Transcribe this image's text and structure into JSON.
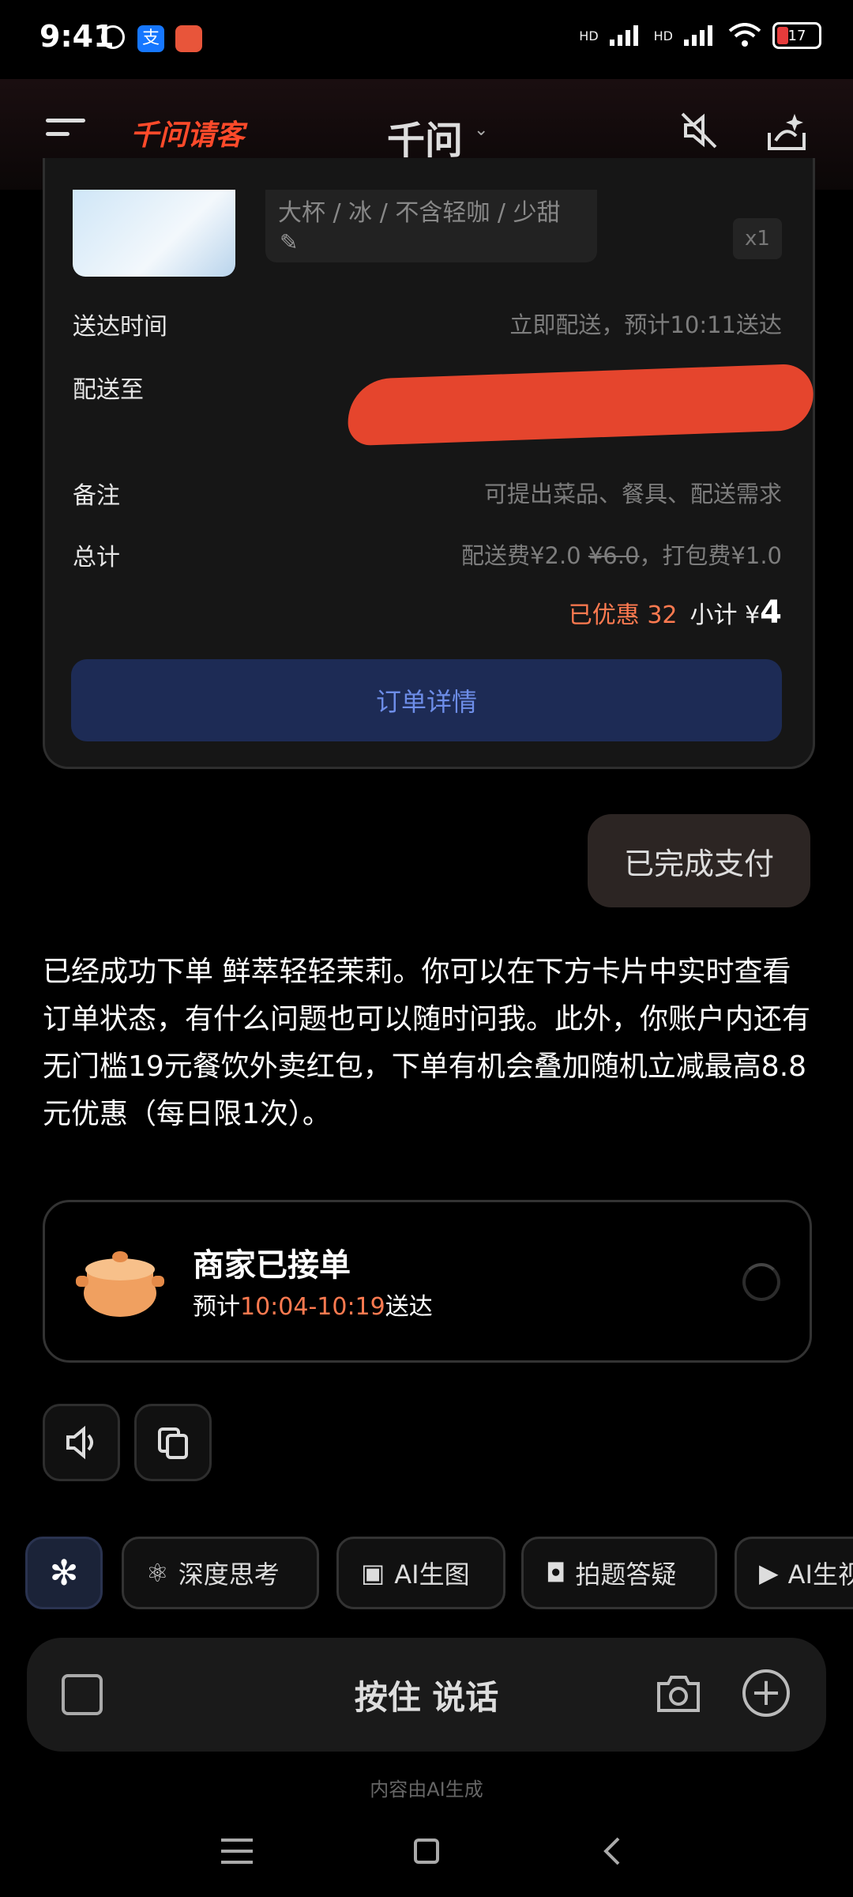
{
  "status_bar": {
    "time": "9:41",
    "signal1": "HD",
    "signal2": "HD",
    "battery": "17"
  },
  "header": {
    "brand": "千问请客",
    "title": "千问"
  },
  "order": {
    "spec": "大杯 / 冰 / 不含轻咖 / 少甜",
    "qty": "x1",
    "delivery_time_label": "送达时间",
    "delivery_time_value": "立即配送，预计10:11送达",
    "address_label": "配送至",
    "note_label": "备注",
    "note_placeholder": "可提出菜品、餐具、配送需求",
    "total_label": "总计",
    "total_fees_prefix": "配送费¥2.0 ",
    "total_fees_strike": "¥6.0",
    "total_fees_suffix": "，打包费¥1.0",
    "discount_label": "已优惠",
    "discount_value": "32",
    "subtotal_label": "小计 ¥",
    "subtotal_value": "4",
    "details_button": "订单详情"
  },
  "user_message": "已完成支付",
  "assistant_reply": "已经成功下单 鲜萃轻轻茉莉。你可以在下方卡片中实时查看订单状态，有什么问题也可以随时问我。此外，你账户内还有无门槛19元餐饮外卖红包，下单有机会叠加随机立减最高8.8元优惠（每日限1次）。",
  "status_card": {
    "title": "商家已接单",
    "sub_prefix": "预计",
    "sub_time": "10:04-10:19",
    "sub_suffix": "送达"
  },
  "chips": [
    "深度思考",
    "AI生图",
    "拍题答疑",
    "AI生视"
  ],
  "input": {
    "hold_to_talk": "按住 说话"
  },
  "footer_note": "内容由AI生成",
  "icons": [
    "alarm-icon",
    "alipay-icon",
    "app-icon",
    "wifi-icon",
    "menu-icon",
    "mute-icon",
    "new-chat-icon",
    "speaker-icon",
    "copy-icon",
    "sparkle-icon",
    "keyboard-icon",
    "camera-icon",
    "plus-icon"
  ]
}
